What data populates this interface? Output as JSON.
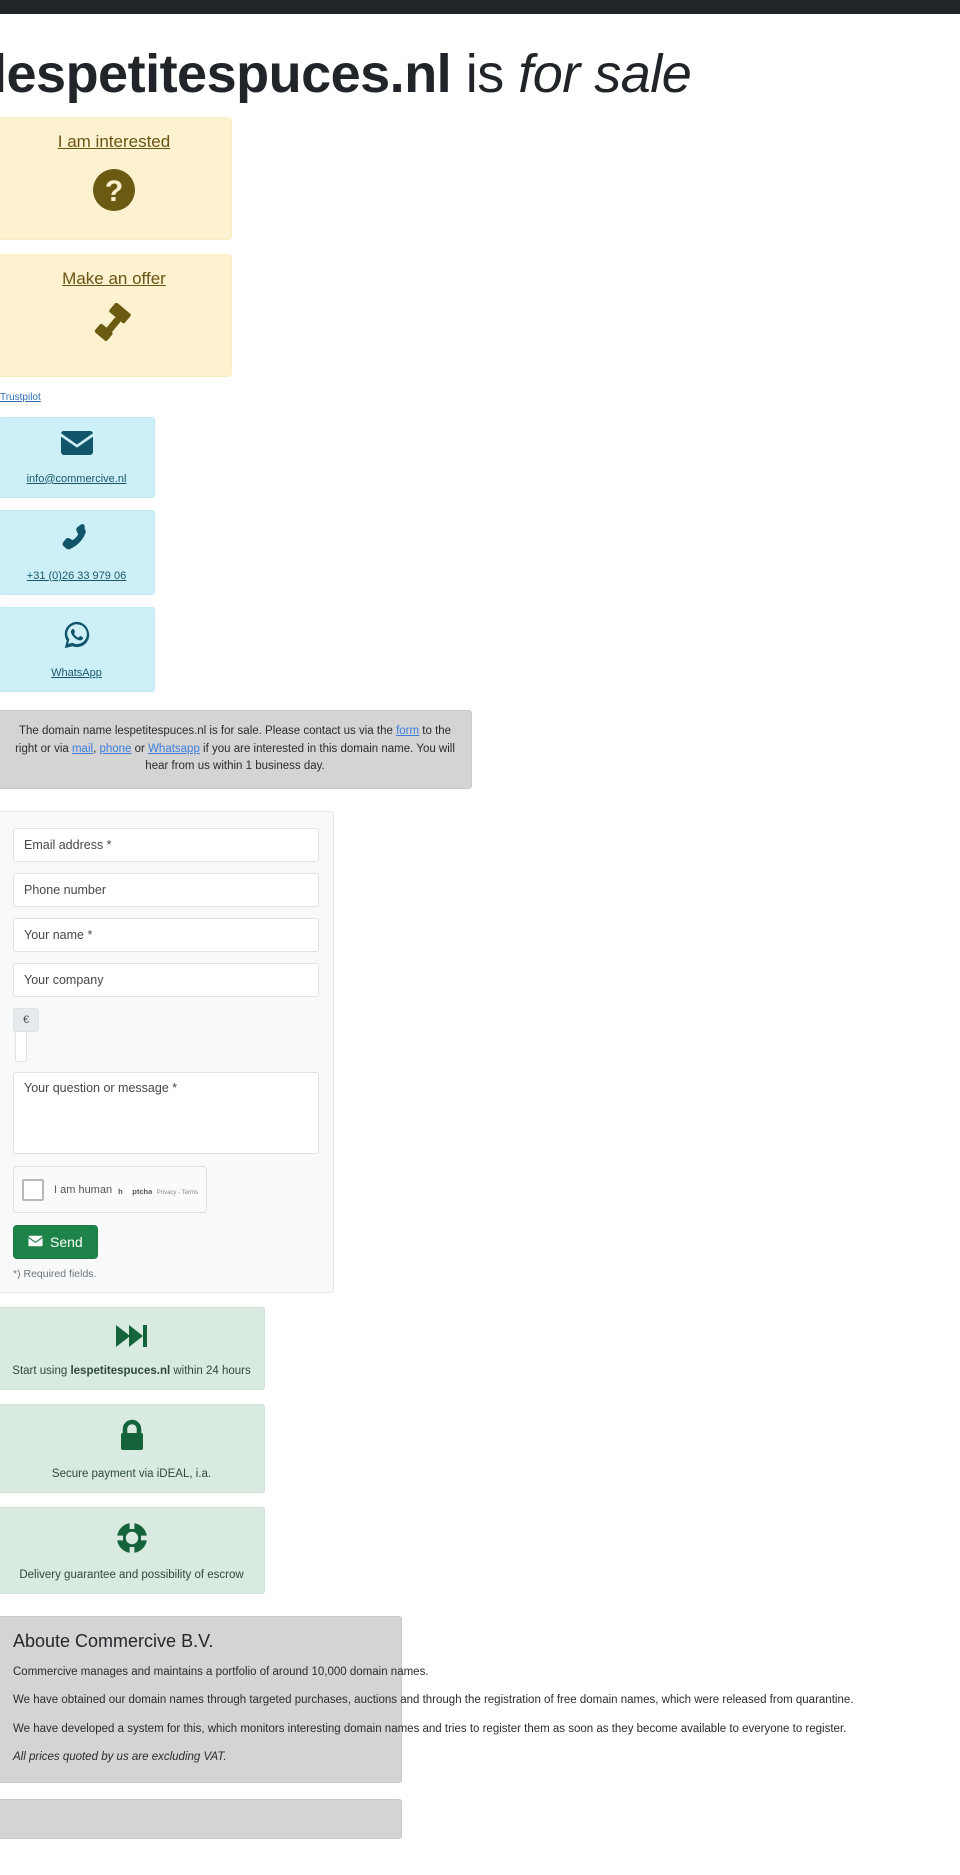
{
  "header": {
    "domain": "lespetitespuces.nl",
    "is_word": " is ",
    "for_sale": "for sale"
  },
  "cta_cards": [
    {
      "label": "I am interested",
      "icon": "question-circle-icon"
    },
    {
      "label": "Make an offer",
      "icon": "gavel-icon"
    }
  ],
  "trustpilot": {
    "label": "Trustpilot"
  },
  "contact_cards": [
    {
      "label": "info@commercive.nl",
      "icon": "envelope-icon"
    },
    {
      "label": "+31 (0)26 33 979 06",
      "icon": "phone-icon"
    },
    {
      "label": "WhatsApp",
      "icon": "whatsapp-icon"
    }
  ],
  "info": {
    "part1": "The domain name lespetitespuces.nl is for sale. Please contact us via the ",
    "link_form": "form",
    "part2": " to the right or via ",
    "link_mail": "mail",
    "part3": ", ",
    "link_phone": "phone",
    "part4": " or ",
    "link_whatsapp": "Whatsapp",
    "part5": " if you are interested in this domain name. You will hear from us within 1 business day."
  },
  "form": {
    "email_placeholder": "Email address *",
    "phone_placeholder": "Phone number",
    "name_placeholder": "Your name *",
    "company_placeholder": "Your company",
    "price_prefix": "€",
    "price_value": "",
    "message_placeholder": "Your question or message *",
    "captcha": {
      "checkbox_label": "I am human",
      "brand": "hCaptcha",
      "terms": "Privacy - Terms"
    },
    "send_label": "Send",
    "required_note": "*) Required fields."
  },
  "features": [
    {
      "icon": "fast-forward-icon",
      "prefix": "Start using ",
      "strong": "lespetitespuces.nl",
      "suffix": " within 24 hours"
    },
    {
      "icon": "lock-icon",
      "prefix": "Secure payment via iDEAL, i.a.",
      "strong": "",
      "suffix": ""
    },
    {
      "icon": "life-ring-icon",
      "prefix": "Delivery guarantee and possibility of escrow",
      "strong": "",
      "suffix": ""
    }
  ],
  "about": {
    "title": "Aboute Commercive B.V.",
    "p1": "Commercive manages and maintains a portfolio of around 10,000 domain names.",
    "p2": "We have obtained our domain names through targeted purchases, auctions and through the registration of free domain names, which were released from quarantine.",
    "p3": "We have developed a system for this, which monitors interesting domain names and tries to register them as soon as they become available to everyone to register.",
    "p4": "All prices quoted by us are excluding VAT."
  },
  "colors": {
    "topbar": "#212529",
    "cta_bg": "#fcf2cf",
    "cta_icon": "#6b5a12",
    "contact_bg": "#cdf0f8",
    "contact_icon": "#11556a",
    "info_bg": "#d4d4d4",
    "feature_bg": "#d9ebe0",
    "feature_icon": "#14633a",
    "send_btn": "#1d8348",
    "link": "#3b7ddd"
  }
}
